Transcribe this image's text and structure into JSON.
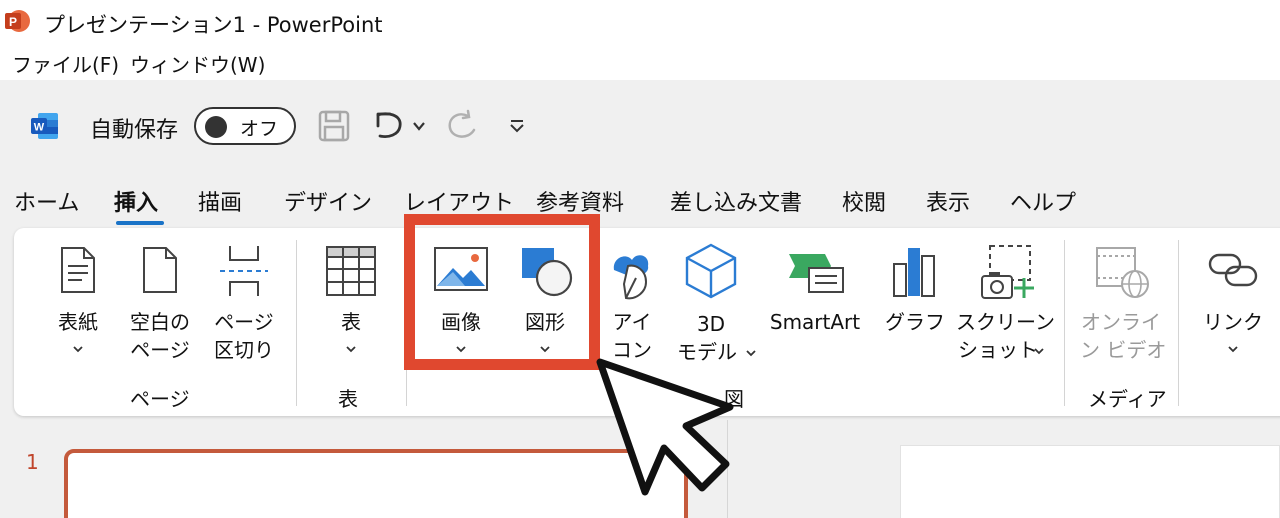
{
  "window": {
    "title": "プレゼンテーション1 - PowerPoint"
  },
  "menubar": {
    "items": [
      "ファイル(F)",
      "ウィンドウ(W)"
    ]
  },
  "qat": {
    "autosave_label": "自動保存",
    "autosave_state": "オフ"
  },
  "ribbon": {
    "tabs": [
      "ホーム",
      "挿入",
      "描画",
      "デザイン",
      "レイアウト",
      "参考資料",
      "差し込み文書",
      "校閲",
      "表示",
      "ヘルプ"
    ],
    "active_tab": "挿入",
    "buttons": {
      "cover": [
        "表紙"
      ],
      "blank_page": [
        "空白の",
        "ページ"
      ],
      "page_break": [
        "ページ",
        "区切り"
      ],
      "table": [
        "表"
      ],
      "picture": [
        "画像"
      ],
      "shapes": [
        "図形"
      ],
      "icons": [
        "アイ",
        "コン"
      ],
      "models3d": [
        "3D",
        "モデル"
      ],
      "smartart": [
        "SmartArt"
      ],
      "chart": [
        "グラフ"
      ],
      "screenshot": [
        "スクリーン",
        "ショット"
      ],
      "online_video": [
        "オンライ",
        "ン ビデオ"
      ],
      "link": [
        "リンク"
      ]
    },
    "groups": {
      "pages": "ページ",
      "table": "表",
      "illustrations": "図",
      "media": "メディア"
    }
  },
  "slides_panel": {
    "slide_number": "1"
  },
  "colors": {
    "accent_blue": "#1a73c7",
    "highlight_red": "#e0482f",
    "powerpoint_orange": "#c43e1c",
    "word_blue": "#185abd"
  }
}
